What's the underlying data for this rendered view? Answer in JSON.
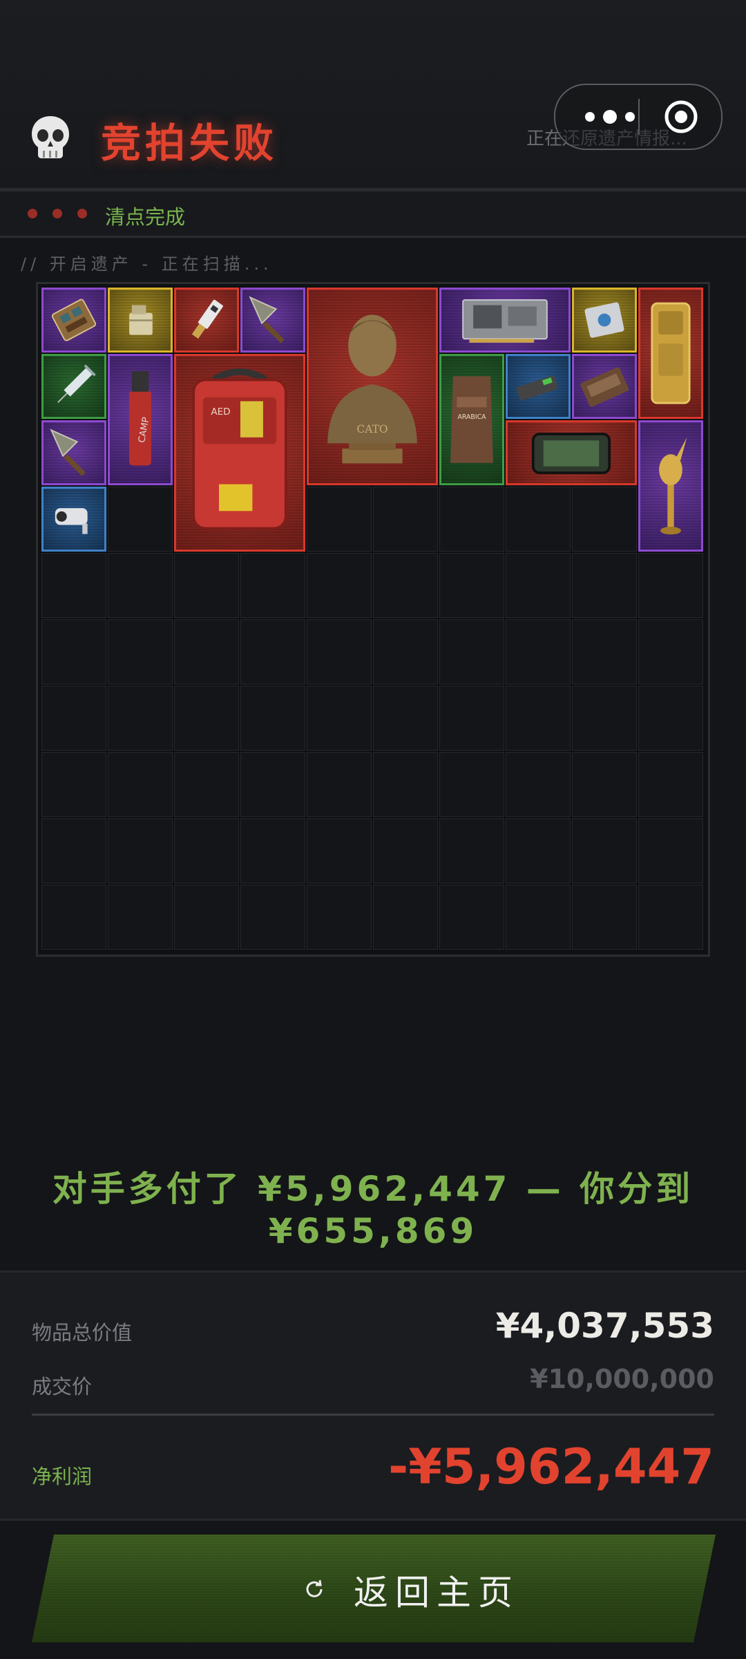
{
  "header": {
    "title": "竞拍失败",
    "restore_text": "正在还原遗产情报...",
    "title_color": "#e2432f"
  },
  "status": {
    "text": "清点完成",
    "dot_color": "#9a2e26"
  },
  "scan_text": "// 开启遗产 - 正在扫描...",
  "grid": {
    "columns": 10,
    "rows": 10,
    "items": [
      {
        "name": "circuit-board-icon",
        "rarity": "purple"
      },
      {
        "name": "zippo-lighter-icon",
        "rarity": "gold"
      },
      {
        "name": "usb-drive-icon",
        "rarity": "red"
      },
      {
        "name": "arrowhead-icon",
        "rarity": "purple"
      },
      {
        "name": "cato-bust-icon",
        "rarity": "red"
      },
      {
        "name": "graphics-card-icon",
        "rarity": "purple"
      },
      {
        "name": "cpu-chip-icon",
        "rarity": "gold"
      },
      {
        "name": "gold-bar-icon",
        "rarity": "red"
      },
      {
        "name": "syringe-icon",
        "rarity": "green"
      },
      {
        "name": "gas-canister-icon",
        "rarity": "purple"
      },
      {
        "name": "aed-defibrillator-icon",
        "rarity": "red"
      },
      {
        "name": "coffee-bag-icon",
        "rarity": "green"
      },
      {
        "name": "usb-stick-icon",
        "rarity": "blue"
      },
      {
        "name": "cassette-tape-icon",
        "rarity": "purple"
      },
      {
        "name": "arrowhead-icon",
        "rarity": "purple"
      },
      {
        "name": "tablet-device-icon",
        "rarity": "red"
      },
      {
        "name": "golden-statuette-icon",
        "rarity": "purple"
      },
      {
        "name": "security-camera-icon",
        "rarity": "blue"
      }
    ]
  },
  "result": {
    "line1": "对手多付了 ¥5,962,447 — 你分到",
    "line2": "¥655,869"
  },
  "summary": {
    "items_total_label": "物品总价值",
    "items_total_value": "¥4,037,553",
    "deal_price_label": "成交价",
    "deal_price_value": "¥10,000,000",
    "net_profit_label": "净利润",
    "net_profit_value": "-¥5,962,447"
  },
  "button": {
    "label": "返回主页",
    "icon": "refresh-icon"
  },
  "colors": {
    "accent_red": "#e2432f",
    "accent_green": "#7fb24f",
    "background": "#141518"
  }
}
